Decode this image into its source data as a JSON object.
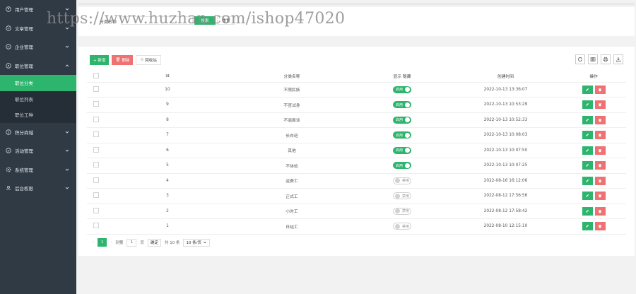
{
  "watermark": "https://www.huzhan.com/ishop47020",
  "sidebar": {
    "items": [
      {
        "label": "用户管理",
        "icon": "user-circle-icon"
      },
      {
        "label": "文章管理",
        "icon": "article-icon"
      },
      {
        "label": "企业管理",
        "icon": "company-icon"
      },
      {
        "label": "职位管理",
        "icon": "job-icon",
        "expanded": true,
        "children": [
          {
            "label": "职位分类",
            "active": true
          },
          {
            "label": "职位列表"
          },
          {
            "label": "职位工种"
          }
        ]
      },
      {
        "label": "积分商城",
        "icon": "points-icon"
      },
      {
        "label": "活动管理",
        "icon": "activity-icon"
      },
      {
        "label": "系统管理",
        "icon": "gear-icon"
      },
      {
        "label": "后台权限",
        "icon": "admin-icon"
      }
    ]
  },
  "search": {
    "label": "分类名称",
    "value": "",
    "search_btn": "搜索",
    "reset_btn": "重置"
  },
  "toolbar": {
    "add_label": "+ 新增",
    "delete_label": "删除",
    "recycle_label": "回收站",
    "right_icons": [
      "refresh-icon",
      "columns-icon",
      "print-icon",
      "export-icon"
    ]
  },
  "table": {
    "headers": [
      "",
      "id",
      "分类名称",
      "显示 隐藏",
      "创建时间",
      "操作"
    ],
    "rows": [
      {
        "id": "10",
        "name": "不限民族",
        "status": "启用",
        "on": true,
        "time": "2022-10-13 13:36:07"
      },
      {
        "id": "9",
        "name": "不查试身",
        "status": "启用",
        "on": true,
        "time": "2022-10-13 10:53:29"
      },
      {
        "id": "8",
        "name": "不逼面谈",
        "status": "启用",
        "on": true,
        "time": "2022-10-13 10:52:33"
      },
      {
        "id": "7",
        "name": "长白班",
        "status": "启用",
        "on": true,
        "time": "2022-10-13 10:08:03"
      },
      {
        "id": "6",
        "name": "其他",
        "status": "启用",
        "on": true,
        "time": "2022-10-13 10:07:50"
      },
      {
        "id": "5",
        "name": "不体检",
        "status": "启用",
        "on": true,
        "time": "2022-10-13 10:07:25"
      },
      {
        "id": "4",
        "name": "返费工",
        "status": "禁用",
        "on": false,
        "time": "2022-08-16 16:12:06"
      },
      {
        "id": "3",
        "name": "正式工",
        "status": "禁用",
        "on": false,
        "time": "2022-08-12 17:56:56"
      },
      {
        "id": "2",
        "name": "小时工",
        "status": "禁用",
        "on": false,
        "time": "2022-08-12 17:58:42"
      },
      {
        "id": "1",
        "name": "日结工",
        "status": "禁用",
        "on": false,
        "time": "2022-08-10 12:15:10"
      }
    ]
  },
  "pager": {
    "current": "1",
    "goto_label": "到第",
    "page_input": "1",
    "page_unit": "页",
    "confirm": "确定",
    "total": "共 10 条",
    "per_page": "10 条/页"
  },
  "colors": {
    "accent": "#2db46d",
    "danger": "#f07171",
    "sidebar": "#2f3a45"
  }
}
